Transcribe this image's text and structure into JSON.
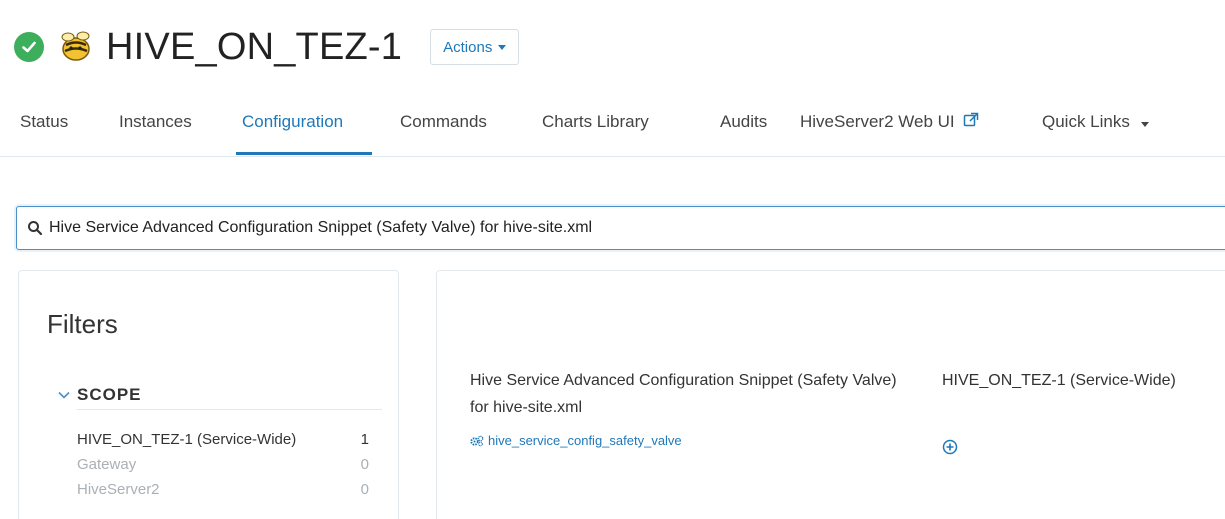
{
  "service": {
    "title": "HIVE_ON_TEZ-1",
    "status": "good",
    "status_color": "#3cae5c",
    "status_icon": "check-circle-icon",
    "service_icon": "hive-bee-icon",
    "actions_label": "Actions"
  },
  "tabs": [
    {
      "label": "Status",
      "active": false
    },
    {
      "label": "Instances",
      "active": false
    },
    {
      "label": "Configuration",
      "active": true
    },
    {
      "label": "Commands",
      "active": false
    },
    {
      "label": "Charts Library",
      "active": false
    },
    {
      "label": "Audits",
      "active": false
    },
    {
      "label": "HiveServer2 Web UI",
      "active": false,
      "icon": "external-link-icon"
    },
    {
      "label": "Quick Links",
      "active": false,
      "icon": "caret-down-icon"
    }
  ],
  "search": {
    "value": "Hive Service Advanced Configuration Snippet (Safety Valve) for hive-site.xml",
    "icon": "search-icon"
  },
  "filters": {
    "title": "Filters",
    "scope_label": "SCOPE",
    "scope_items": [
      {
        "label": "HIVE_ON_TEZ-1 (Service-Wide)",
        "count": "1"
      },
      {
        "label": "Gateway",
        "count": "0"
      },
      {
        "label": "HiveServer2",
        "count": "0"
      }
    ]
  },
  "config": {
    "property_name": "Hive Service Advanced Configuration Snippet (Safety Valve) for hive-site.xml",
    "property_key": "hive_service_config_safety_valve",
    "scope": "HIVE_ON_TEZ-1 (Service-Wide)"
  },
  "colors": {
    "accent": "#1f78b8",
    "muted": "#a9b0b6",
    "border": "#e3e8ec"
  }
}
